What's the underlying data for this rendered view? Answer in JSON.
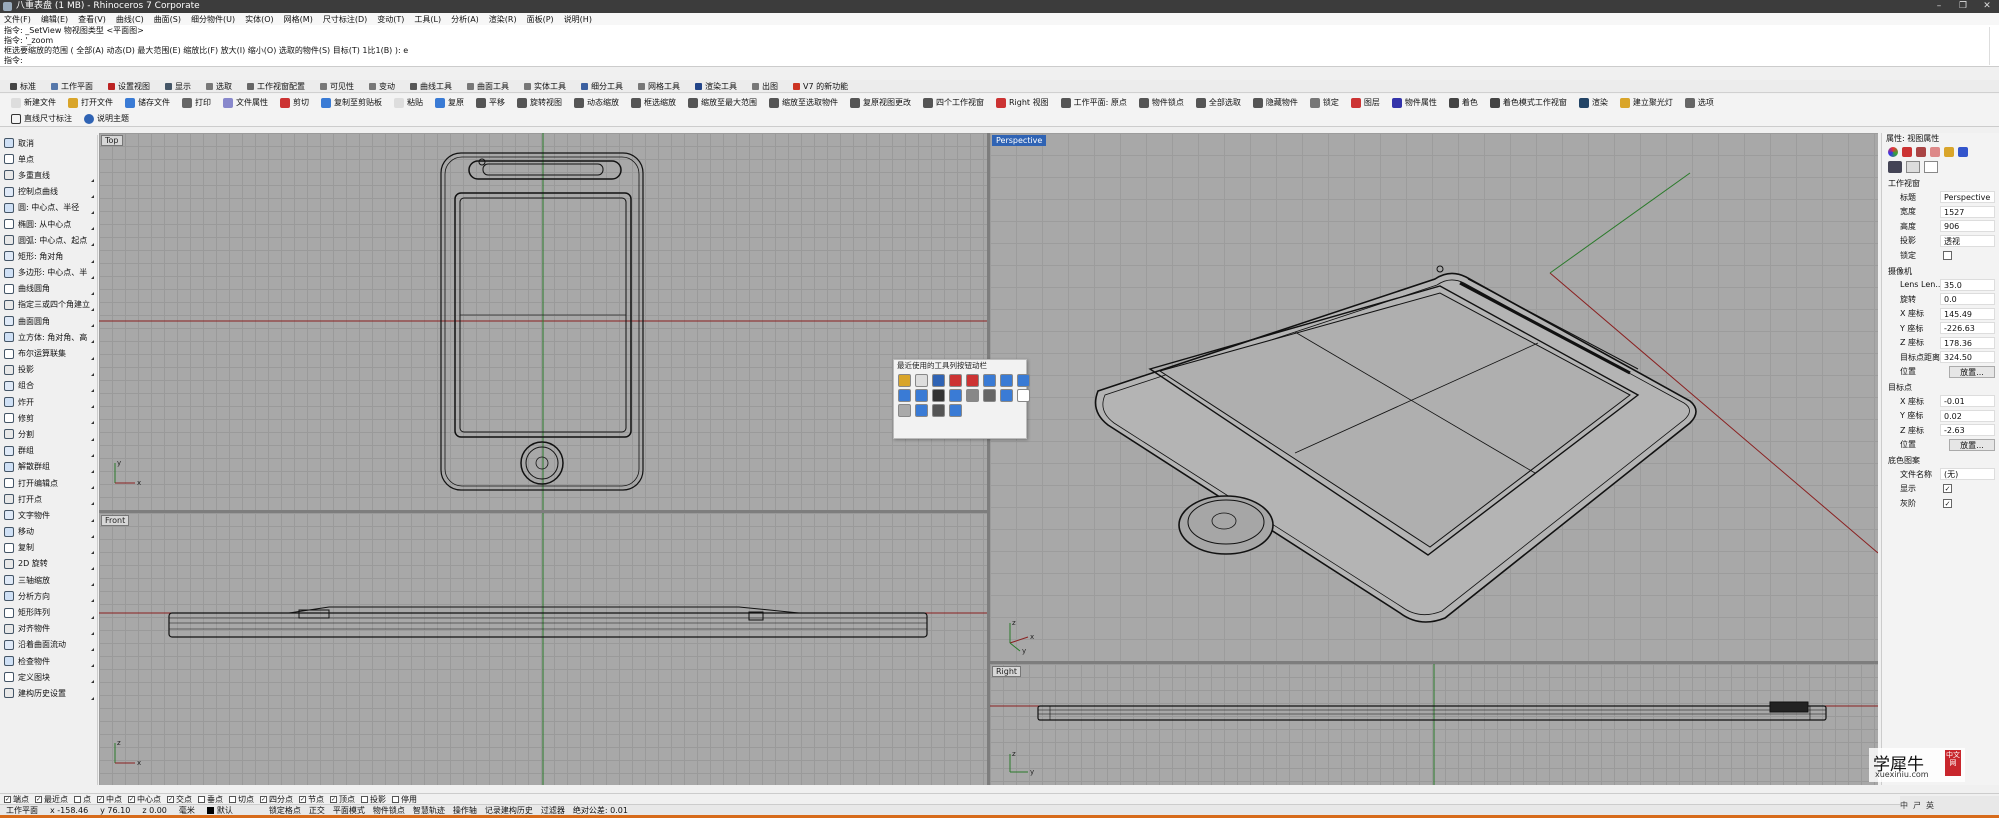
{
  "window": {
    "title": "八重表盘 (1 MB) - Rhinoceros 7 Corporate",
    "controls": [
      "–",
      "❐",
      "✕"
    ]
  },
  "menu": [
    "文件(F)",
    "编辑(E)",
    "查看(V)",
    "曲线(C)",
    "曲面(S)",
    "细分物件(U)",
    "实体(O)",
    "网格(M)",
    "尺寸标注(D)",
    "变动(T)",
    "工具(L)",
    "分析(A)",
    "渲染(R)",
    "面板(P)",
    "说明(H)"
  ],
  "command": {
    "history": [
      "指令: _SetView 物视图类型 <平面图>",
      "指令: '_zoom",
      "框选要缩放的范围 ( 全部(A)  动态(D)  最大范围(E)  缩放比(F)  放大(I)  缩小(O)  选取的物件(S)  目标(T)  1比1(B) ): e"
    ],
    "prompt": "指令:",
    "value": ""
  },
  "tabs": [
    {
      "label": "标准",
      "color": "#444444"
    },
    {
      "label": "工作平面",
      "color": "#5577aa"
    },
    {
      "label": "设置视图",
      "color": "#bb2222"
    },
    {
      "label": "显示",
      "color": "#445566"
    },
    {
      "label": "选取",
      "color": "#777777"
    },
    {
      "label": "工作视窗配置",
      "color": "#666666"
    },
    {
      "label": "可见性",
      "color": "#777777"
    },
    {
      "label": "变动",
      "color": "#777777"
    },
    {
      "label": "曲线工具",
      "color": "#555555"
    },
    {
      "label": "曲面工具",
      "color": "#777777"
    },
    {
      "label": "实体工具",
      "color": "#777777"
    },
    {
      "label": "细分工具",
      "color": "#3a5fa0"
    },
    {
      "label": "网格工具",
      "color": "#777777"
    },
    {
      "label": "渲染工具",
      "color": "#224488"
    },
    {
      "label": "出图",
      "color": "#777777"
    },
    {
      "label": "V7 的新功能",
      "color": "#cc3322"
    }
  ],
  "toolbar_main": [
    "新建文件",
    "打开文件",
    "储存文件",
    "打印",
    "文件属性",
    "剪切",
    "复制至剪贴板",
    "粘贴",
    "复原",
    "平移",
    "旋转视图",
    "动态缩放",
    "框选缩放",
    "缩放至最大范围",
    "缩放至选取物件",
    "复原视图更改",
    "四个工作视窗",
    "Right 视图",
    "工作平面: 原点",
    "物件锁点",
    "全部选取",
    "隐藏物件",
    "锁定",
    "图层",
    "物件属性",
    "着色",
    "着色模式工作视窗",
    "渲染",
    "建立聚光灯",
    "选项"
  ],
  "toolbar_sub": [
    "直线尺寸标注",
    "说明主题"
  ],
  "sidebar": [
    "取消",
    "单点",
    "多重直线",
    "控制点曲线",
    "圆: 中心点、半径",
    "椭圆: 从中心点",
    "圆弧: 中心点、起点",
    "矩形: 角对角",
    "多边形: 中心点、半",
    "曲线圆角",
    "指定三或四个角建立",
    "曲面圆角",
    "立方体: 角对角、高",
    "布尔运算联集",
    "投影",
    "组合",
    "炸开",
    "修剪",
    "分割",
    "群组",
    "解散群组",
    "打开编辑点",
    "打开点",
    "文字物件",
    "移动",
    "复制",
    "2D 旋转",
    "三轴缩放",
    "分析方向",
    "矩形阵列",
    "对齐物件",
    "沿着曲面流动",
    "检查物件",
    "定义图块",
    "建构历史设置"
  ],
  "viewports": {
    "top": {
      "label": "Top"
    },
    "front": {
      "label": "Front"
    },
    "perspective": {
      "label": "Perspective"
    },
    "right": {
      "label": "Right"
    }
  },
  "axis": {
    "x": "x",
    "y": "y",
    "z": "z"
  },
  "float_panel": {
    "title": "最近使用的工具列按钮动栏"
  },
  "properties": {
    "header": "属性: 视图属性",
    "section_viewport": "工作视窗",
    "title_label": "标题",
    "title_value": "Perspective",
    "width_label": "宽度",
    "width_value": "1527",
    "height_label": "高度",
    "height_value": "906",
    "projection_label": "投影",
    "projection_value": "透视",
    "locked_label": "锁定",
    "section_camera": "摄像机",
    "lens_label": "Lens Len...",
    "lens_value": "35.0",
    "rotation_label": "旋转",
    "rotation_value": "0.0",
    "cam_x_label": "X 座标",
    "cam_x_value": "145.49",
    "cam_y_label": "Y 座标",
    "cam_y_value": "-226.63",
    "cam_z_label": "Z 座标",
    "cam_z_value": "178.36",
    "dist_label": "目标点距离",
    "dist_value": "324.50",
    "position_label": "位置",
    "place_button": "放置...",
    "section_target": "目标点",
    "tgt_x_label": "X 座标",
    "tgt_x_value": "-0.01",
    "tgt_y_label": "Y 座标",
    "tgt_y_value": "0.02",
    "tgt_z_label": "Z 座标",
    "tgt_z_value": "-2.63",
    "tgt_position_label": "位置",
    "tgt_place_button": "放置...",
    "section_bg": "底色图案",
    "filename_label": "文件名称",
    "filename_value": "(无)",
    "show_label": "显示",
    "gray_label": "灰阶"
  },
  "osnap": [
    {
      "label": "端点",
      "checked": true
    },
    {
      "label": "最近点",
      "checked": true
    },
    {
      "label": "点",
      "checked": false
    },
    {
      "label": "中点",
      "checked": true
    },
    {
      "label": "中心点",
      "checked": true
    },
    {
      "label": "交点",
      "checked": true
    },
    {
      "label": "垂点",
      "checked": false
    },
    {
      "label": "切点",
      "checked": false
    },
    {
      "label": "四分点",
      "checked": true
    },
    {
      "label": "节点",
      "checked": true
    },
    {
      "label": "顶点",
      "checked": true
    },
    {
      "label": "投影",
      "checked": false
    },
    {
      "label": "停用",
      "checked": false
    }
  ],
  "status": {
    "cplane": "工作平面",
    "x": "x -158.46",
    "y": "y 76.10",
    "z": "z 0.00",
    "unit": "毫米",
    "layer": "默认",
    "items": [
      "锁定格点",
      "正交",
      "平面模式",
      "物件锁点",
      "智慧轨迹",
      "操作轴",
      "记录建构历史",
      "过滤器",
      "绝对公差: 0.01"
    ]
  },
  "watermark": {
    "main": "学犀牛",
    "badge": "中文网",
    "url": "xuexiniu.com"
  },
  "tray": [
    "中",
    "ㄕ",
    "英"
  ]
}
